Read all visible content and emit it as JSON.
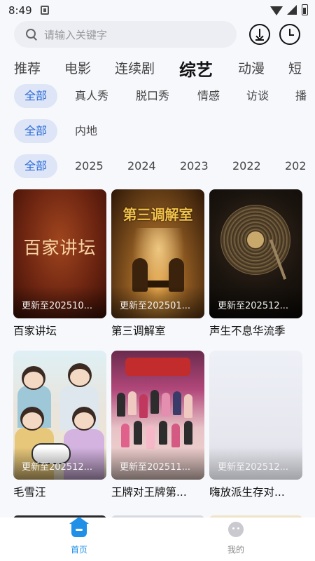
{
  "status_bar": {
    "time": "8:49"
  },
  "search": {
    "placeholder": "请输入关键字"
  },
  "category_tabs": [
    {
      "label": "推荐"
    },
    {
      "label": "电影"
    },
    {
      "label": "连续剧"
    },
    {
      "label": "综艺",
      "active": true
    },
    {
      "label": "动漫"
    },
    {
      "label": "短"
    }
  ],
  "filters": {
    "type": [
      "全部",
      "真人秀",
      "脱口秀",
      "情感",
      "访谈",
      "播"
    ],
    "region": [
      "全部",
      "内地"
    ],
    "year": [
      "全部",
      "2025",
      "2024",
      "2023",
      "2022",
      "202"
    ]
  },
  "shows": [
    {
      "title": "百家讲坛",
      "update": "更新至202510...",
      "poster_text": "百家讲坛"
    },
    {
      "title": "第三调解室",
      "update": "更新至202501...",
      "poster_text": "第三调解室"
    },
    {
      "title": "声生不息华流季",
      "update": "更新至202512..."
    },
    {
      "title": "毛雪汪",
      "update": "更新至202512..."
    },
    {
      "title": "王牌对王牌第...",
      "update": "更新至202511..."
    },
    {
      "title": "嗨放派生存对...",
      "update": "更新至202512..."
    }
  ],
  "bottom_nav": [
    {
      "label": "首页",
      "icon": "home-icon",
      "active": true
    },
    {
      "label": "我的",
      "icon": "profile-icon"
    }
  ],
  "colors": {
    "accent": "#2b6cd9",
    "chip_bg": "#dde5f6",
    "nav_active": "#1f8fe8"
  }
}
